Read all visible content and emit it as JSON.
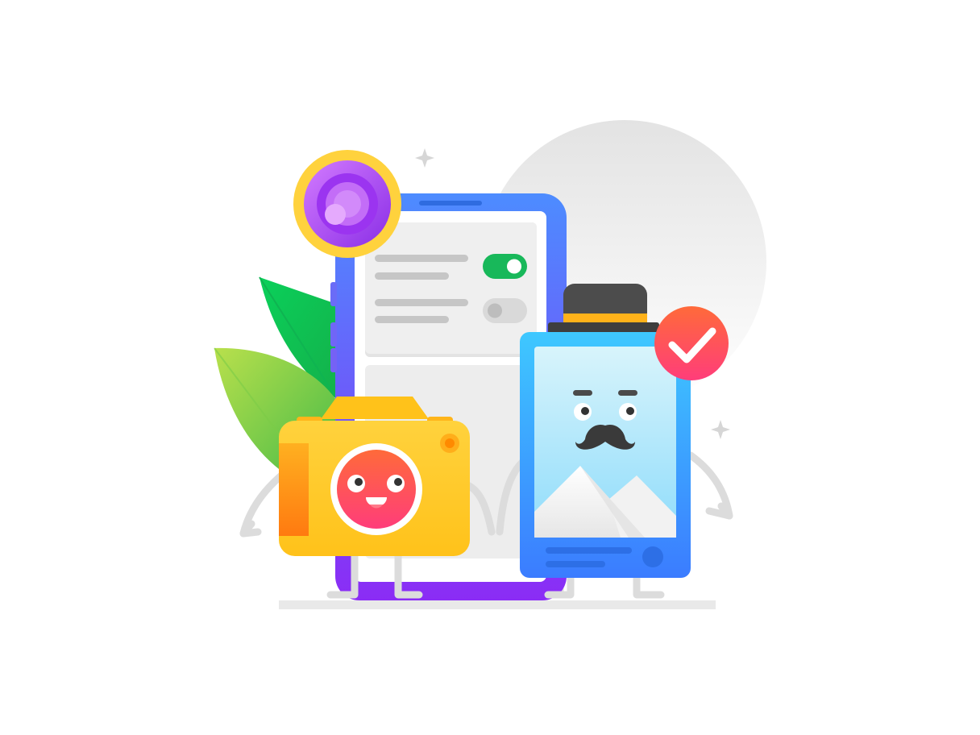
{
  "illustration": {
    "settings_toggles": [
      {
        "state": "on"
      },
      {
        "state": "off"
      }
    ],
    "badge": {
      "status": "checked"
    },
    "icons": [
      "sparkle-icon",
      "lens-icon",
      "checkmark-icon",
      "mountain-photo-icon",
      "toggle-icon",
      "leaf-icon"
    ],
    "colors": {
      "phone_frame": "#5b7bff",
      "phone_base": "#8a1cf5",
      "camera_body": "#ffc727",
      "frame_blue": "#2f8dff",
      "toggle_on": "#18b85a",
      "check_badge": "#ff5a4a",
      "lens_purple": "#b65cf5",
      "lens_ring": "#ffd23d",
      "hat": "#505050",
      "leaf_green": "#12c95a",
      "leaf_lime": "#9fd64a"
    }
  }
}
